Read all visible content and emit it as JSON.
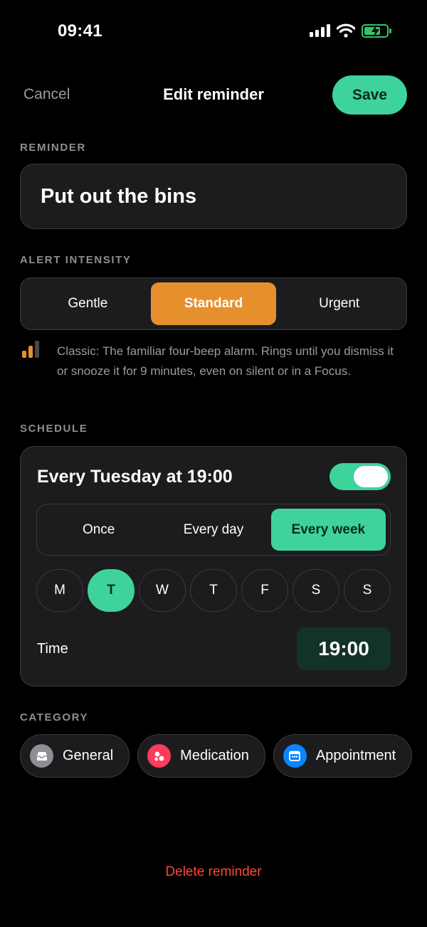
{
  "status_bar": {
    "time": "09:41"
  },
  "nav": {
    "cancel_label": "Cancel",
    "title": "Edit reminder",
    "save_label": "Save"
  },
  "reminder": {
    "section_label": "REMINDER",
    "value": "Put out the bins"
  },
  "intensity": {
    "section_label": "ALERT INTENSITY",
    "options": [
      "Gentle",
      "Standard",
      "Urgent"
    ],
    "selected": "Standard",
    "description": "Classic: The familiar four-beep alarm. Rings until you dismiss it or snooze it for 9 minutes, even on silent or in a Focus.",
    "accent_color": "#e5902d"
  },
  "schedule": {
    "section_label": "SCHEDULE",
    "summary": "Every Tuesday at 19:00",
    "enabled": true,
    "frequency_options": [
      "Once",
      "Every day",
      "Every week"
    ],
    "frequency_selected": "Every week",
    "days": [
      "M",
      "T",
      "W",
      "T",
      "F",
      "S",
      "S"
    ],
    "selected_day_index": 1,
    "time_label": "Time",
    "time_value": "19:00",
    "accent_color": "#3ed39b"
  },
  "category": {
    "section_label": "CATEGORY",
    "items": [
      {
        "label": "General",
        "icon": "tray-icon",
        "color": "#8e8e93"
      },
      {
        "label": "Medication",
        "icon": "pills-icon",
        "color": "#ff3b5c"
      },
      {
        "label": "Appointment",
        "icon": "calendar-icon",
        "color": "#0a84ff"
      }
    ]
  },
  "footer": {
    "delete_label": "Delete reminder",
    "delete_color": "#ff453a"
  }
}
